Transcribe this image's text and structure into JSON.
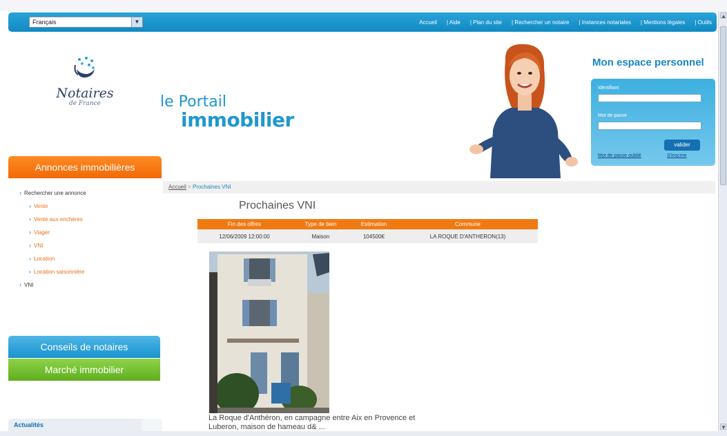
{
  "topbar": {
    "language": "Français",
    "nav": [
      "Accueil",
      "| Aide",
      "| Plan du site",
      "| Rechercher un notaire",
      "| Instances notariales",
      "| Mentions légales",
      "| Outils"
    ]
  },
  "logo": {
    "title": "Notaires",
    "subtitle": "de France"
  },
  "portail": {
    "line1": "le Portail",
    "line2": "immobilier"
  },
  "account": {
    "title": "Mon espace personnel",
    "identifiant_label": "Identifiant",
    "password_label": "Mot de passe",
    "submit_label": "valider",
    "forgot_label": "Mot de passe oublié",
    "register_label": "S'inscrire"
  },
  "sidebar": {
    "annonces_label": "Annonces immobilières",
    "nav": [
      {
        "label": "Rechercher une annonce",
        "level": 1
      },
      {
        "label": "Vente",
        "level": 2
      },
      {
        "label": "Vente aux enchères",
        "level": 2
      },
      {
        "label": "Viager",
        "level": 2
      },
      {
        "label": "VNI",
        "level": 2
      },
      {
        "label": "Location",
        "level": 2
      },
      {
        "label": "Location saisonnière",
        "level": 2
      },
      {
        "label": "VNI",
        "level": 1
      }
    ],
    "conseils_label": "Conseils de notaires",
    "marche_label": "Marché immobilier",
    "actualites_label": "Actualités"
  },
  "breadcrumb": {
    "home": "Accueil",
    "separator": ">",
    "current": "Prochaines VNI"
  },
  "page_title": "Prochaines VNI",
  "table": {
    "headers": [
      "Fin des offres",
      "Type de bien",
      "Estimation",
      "Commune"
    ],
    "rows": [
      [
        "12/06/2009 12:00:00",
        "Maison",
        "104500€",
        "LA ROQUE D'ANTHERON(13)"
      ]
    ]
  },
  "listing": {
    "caption": "La Roque d'Anthéron, en campagne entre Aix en Provence et Luberon, maison de hameau d& ..."
  },
  "colors": {
    "nav_blue": "#1c96cf",
    "orange": "#f07a12",
    "green": "#6cb82a",
    "title_blue": "#1a86c3"
  }
}
